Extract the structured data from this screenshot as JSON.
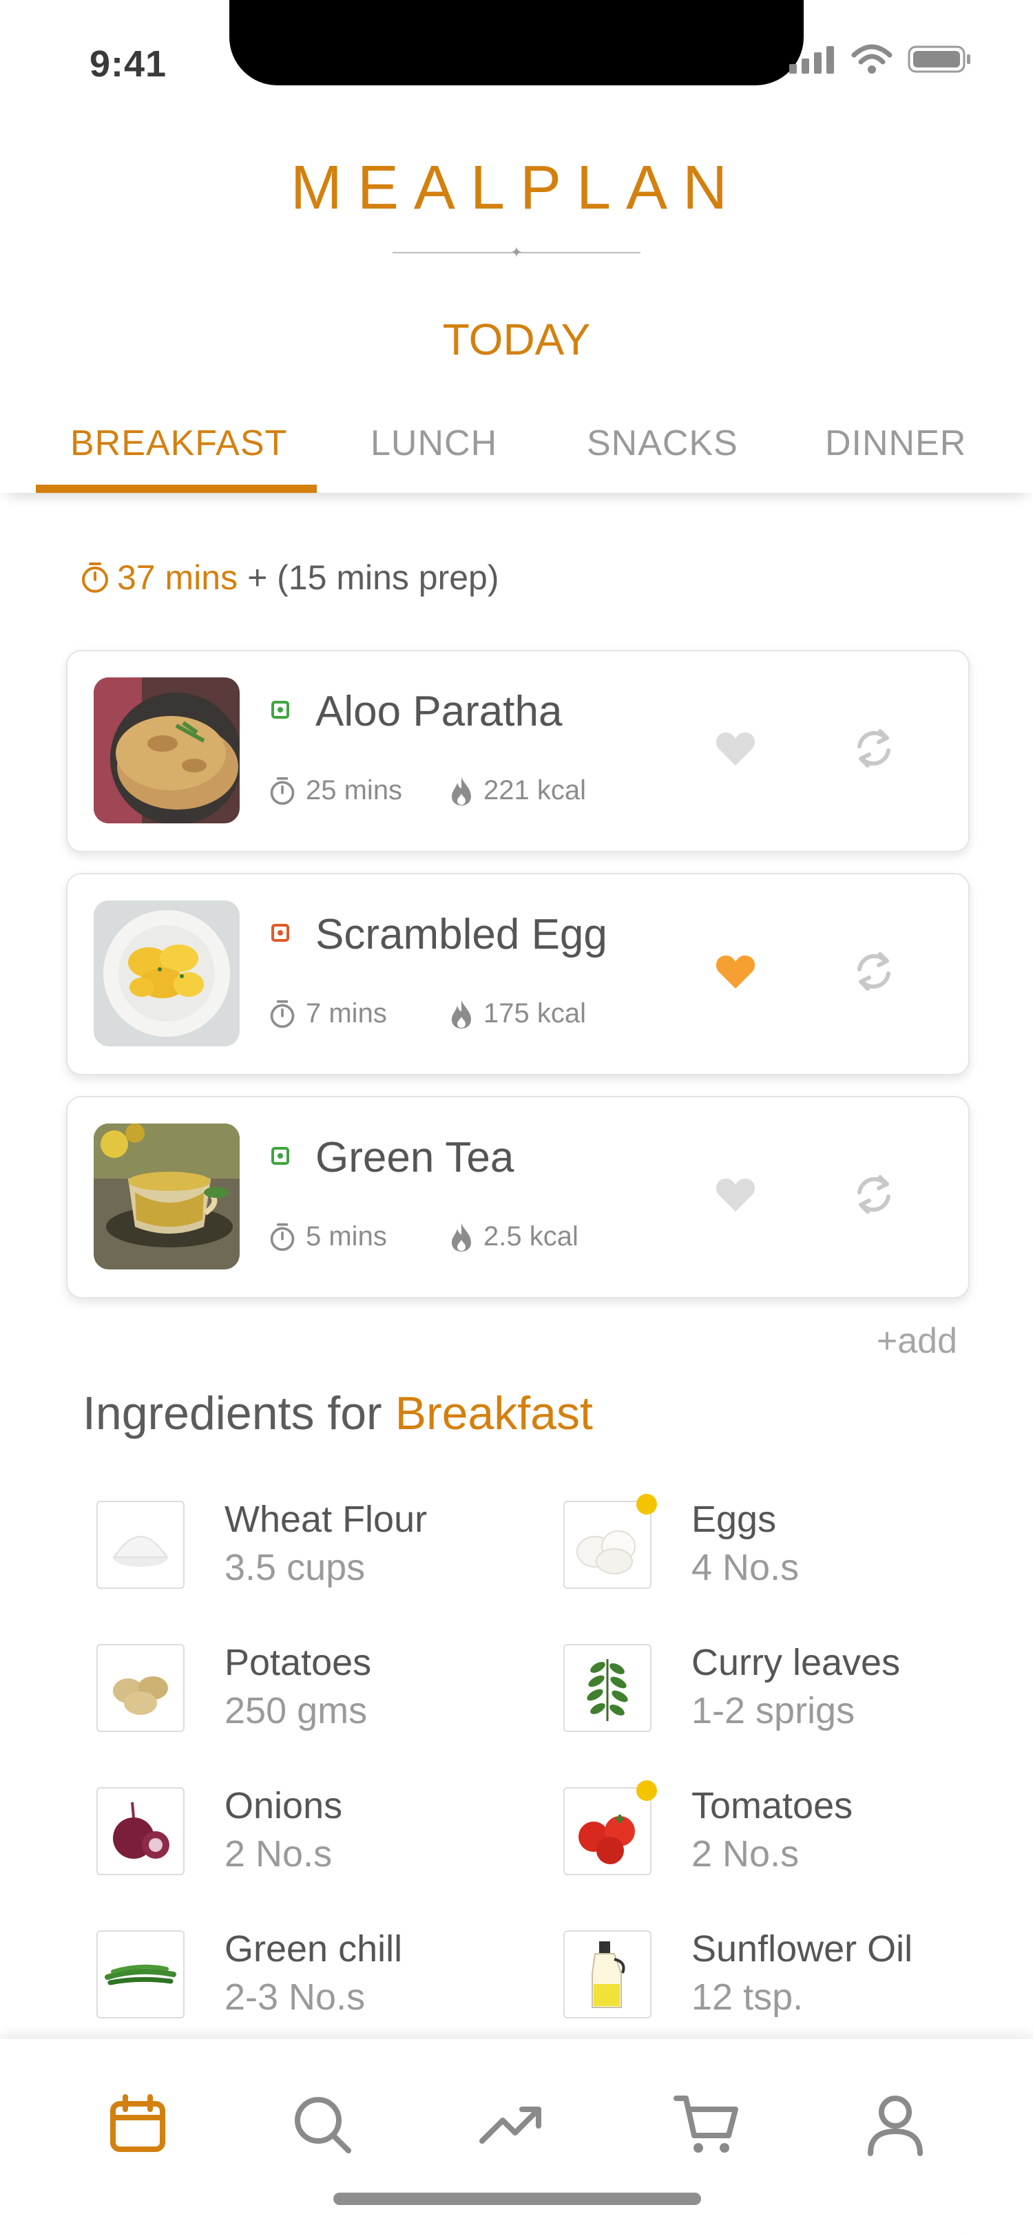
{
  "status": {
    "time": "9:41"
  },
  "app": {
    "title": "MEALPLAN",
    "day": "TODAY"
  },
  "tabs": [
    {
      "label": "BREAKFAST",
      "active": true
    },
    {
      "label": "LUNCH",
      "active": false
    },
    {
      "label": "SNACKS",
      "active": false
    },
    {
      "label": "DINNER",
      "active": false
    }
  ],
  "summary": {
    "cook_time": "37 mins",
    "rest": "+ (15 mins prep)"
  },
  "meals": [
    {
      "name": "Aloo Paratha",
      "time": "25 mins",
      "kcal": "221 kcal",
      "type": "veg",
      "favorite": false
    },
    {
      "name": "Scrambled Egg",
      "time": "7 mins",
      "kcal": "175 kcal",
      "type": "non-veg",
      "favorite": true
    },
    {
      "name": "Green Tea",
      "time": "5 mins",
      "kcal": "2.5 kcal",
      "type": "veg",
      "favorite": false
    }
  ],
  "add_label": "+add",
  "ingredients_title": {
    "prefix": "Ingredients for ",
    "meal": "Breakfast"
  },
  "ingredients": [
    {
      "name": "Wheat Flour",
      "qty": "3.5 cups",
      "flag": false
    },
    {
      "name": "Eggs",
      "qty": "4 No.s",
      "flag": true
    },
    {
      "name": "Potatoes",
      "qty": "250 gms",
      "flag": false
    },
    {
      "name": "Curry leaves",
      "qty": "1-2 sprigs",
      "flag": false
    },
    {
      "name": "Onions",
      "qty": "2 No.s",
      "flag": false
    },
    {
      "name": "Tomatoes",
      "qty": "2 No.s",
      "flag": true
    },
    {
      "name": "Green chill",
      "qty": "2-3 No.s",
      "flag": false
    },
    {
      "name": "Sunflower Oil",
      "qty": "12 tsp.",
      "flag": false
    }
  ],
  "nav": [
    "calendar-icon",
    "search-icon",
    "trending-icon",
    "cart-icon",
    "profile-icon"
  ],
  "colors": {
    "accent": "#d4800f",
    "veg": "#3fa53f",
    "nonveg": "#e05a28",
    "favorite": "#f5a030"
  }
}
